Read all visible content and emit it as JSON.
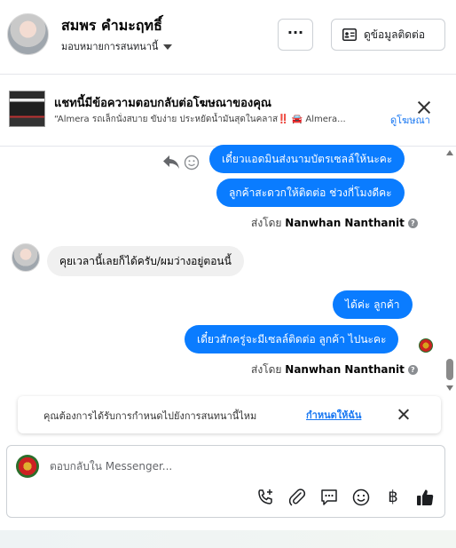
{
  "header": {
    "contact_name": "สมพร คำมะฤทธิ์",
    "assign_label": "มอบหมายการสนทนานี้",
    "more_label": "···",
    "contact_info_label": "ดูข้อมูลติดต่อ"
  },
  "ad_banner": {
    "title": "แชทนี้มีข้อความตอบกลับต่อโฆษณาของคุณ",
    "snippet": "“Almera รถเล็กนั่งสบาย ขับง่าย ประหยัดน้ำมันสุดในคลาส‼️ 🚘 Almera...",
    "link_label": "ดูโฆษณา"
  },
  "messages": [
    {
      "direction": "out",
      "text": "เดี๋ยวแอดมินส่งนามบัตรเซลล์ให้นะคะ"
    },
    {
      "direction": "out",
      "text": "ลูกค้าสะดวกให้ติดต่อ ช่วงกี่โมงดีคะ"
    },
    {
      "direction": "in",
      "text": "คุยเวลานี้เลยก็ได้ครับ/ผมว่างอยู่ตอนนี้"
    },
    {
      "direction": "out",
      "text": "ได้ค่ะ ลูกค้า"
    },
    {
      "direction": "out",
      "text": "เดี๋ยวสักครู่จะมีเซลล์ติดต่อ ลูกค้า ไปนะคะ"
    }
  ],
  "sent_by": {
    "prefix": "ส่งโดย",
    "name": "Nanwhan Nanthanit",
    "info": "?"
  },
  "assign_prompt": {
    "text": "คุณต้องการได้รับการกำหนดไปยังการสนทนานี้ไหม",
    "link_label": "กำหนดให้ฉัน"
  },
  "composer": {
    "placeholder": "ตอบกลับใน Messenger...",
    "currency_symbol": "฿"
  },
  "colors": {
    "outgoing_bubble": "#0a7cff",
    "incoming_bubble": "#f0f0f0",
    "link": "#1877f2"
  },
  "icons": [
    "contact-card-icon",
    "reply-icon",
    "emoji-icon",
    "info-icon",
    "close-icon",
    "phone-add-icon",
    "attachment-icon",
    "saved-reply-icon",
    "emoji-icon",
    "currency-icon",
    "like-icon"
  ]
}
